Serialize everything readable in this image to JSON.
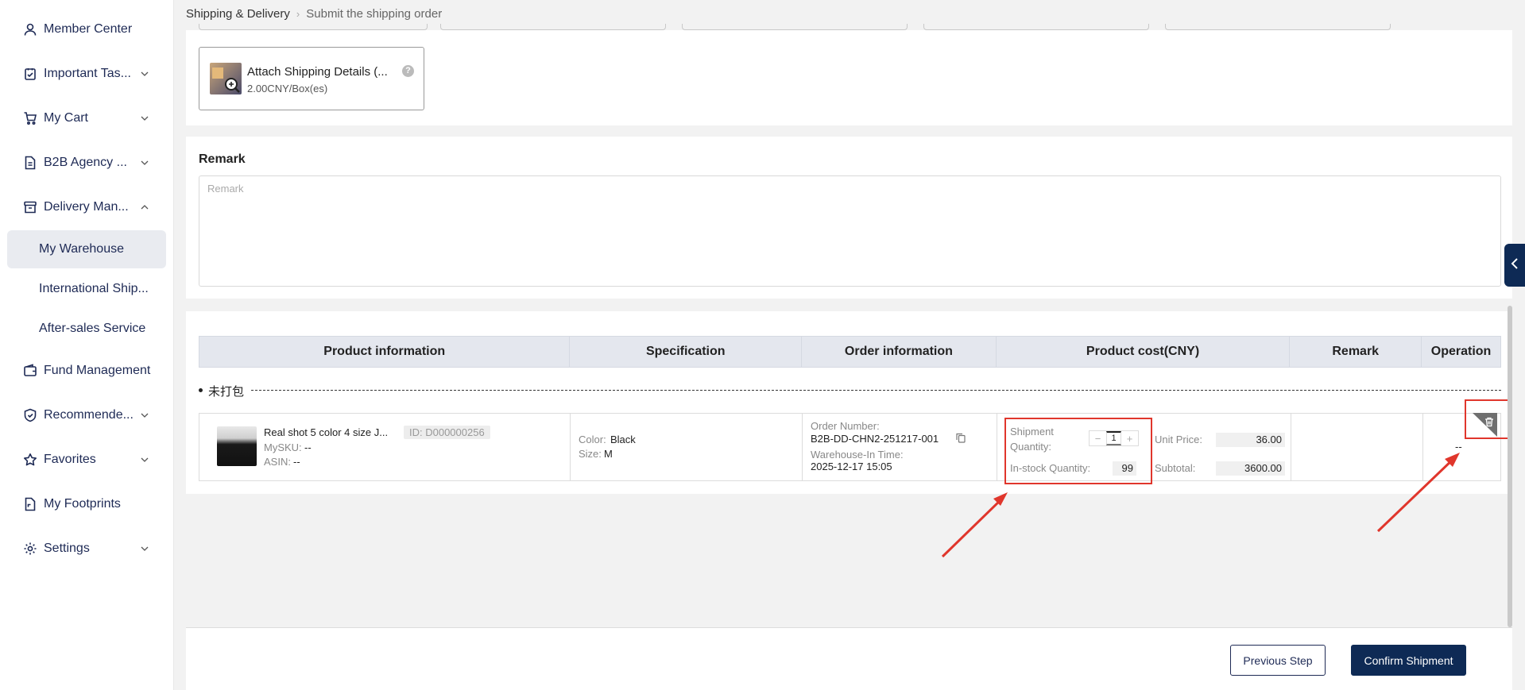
{
  "sidebar": {
    "items": [
      {
        "label": "Member Center",
        "icon": "user-icon",
        "has_chevron": false
      },
      {
        "label": "Important Tas...",
        "icon": "task-icon",
        "has_chevron": true
      },
      {
        "label": "My Cart",
        "icon": "cart-icon",
        "has_chevron": true
      },
      {
        "label": "B2B Agency ...",
        "icon": "document-icon",
        "has_chevron": true
      },
      {
        "label": "Delivery Man...",
        "icon": "box-icon",
        "has_chevron": true,
        "expanded": true
      },
      {
        "label": "Fund Management",
        "icon": "wallet-icon",
        "has_chevron": false
      },
      {
        "label": "Recommende...",
        "icon": "shield-icon",
        "has_chevron": true
      },
      {
        "label": "Favorites",
        "icon": "star-icon",
        "has_chevron": true
      },
      {
        "label": "My Footprints",
        "icon": "footprint-doc-icon",
        "has_chevron": false
      },
      {
        "label": "Settings",
        "icon": "gear-icon",
        "has_chevron": true
      }
    ],
    "sub_items": [
      {
        "label": "My Warehouse",
        "active": true
      },
      {
        "label": "International Ship..."
      },
      {
        "label": "After-sales Service"
      }
    ]
  },
  "breadcrumb": {
    "parent": "Shipping & Delivery",
    "current": "Submit the shipping order"
  },
  "attach_service": {
    "title": "Attach Shipping Details (...",
    "price": "2.00CNY/Box(es)",
    "help": "?"
  },
  "remark": {
    "title": "Remark",
    "placeholder": "Remark"
  },
  "table": {
    "headers": [
      "Product information",
      "Specification",
      "Order information",
      "Product cost(CNY)",
      "Remark",
      "Operation"
    ],
    "group_label": "未打包",
    "row": {
      "product_name": "Real shot 5 color 4 size J...",
      "product_id": "ID: D000000256",
      "mysku_label": "MySKU:",
      "mysku_value": "--",
      "asin_label": "ASIN:",
      "asin_value": "--",
      "color_label": "Color:",
      "color_value": "Black",
      "size_label": "Size:",
      "size_value": "M",
      "order_number_label": "Order Number:",
      "order_number": "B2B-DD-CHN2-251217-001",
      "warehouse_in_label": "Warehouse-In Time:",
      "warehouse_in_time": "2025-12-17 15:05",
      "shipment_qty_label_1": "Shipment",
      "shipment_qty_label_2": "Quantity:",
      "shipment_qty": "1",
      "minus": "−",
      "plus": "+",
      "instock_label": "In-stock Quantity:",
      "instock_qty": "99",
      "unit_price_label": "Unit Price:",
      "unit_price": "36.00",
      "subtotal_label": "Subtotal:",
      "subtotal": "3600.00",
      "remark_value": "",
      "operation_value": "--"
    }
  },
  "footer": {
    "prev_label": "Previous Step",
    "confirm_label": "Confirm Shipment"
  },
  "colors": {
    "navy": "#0e2a55",
    "annotation_red": "#e0362c",
    "header_bg": "#e4e7ee"
  }
}
